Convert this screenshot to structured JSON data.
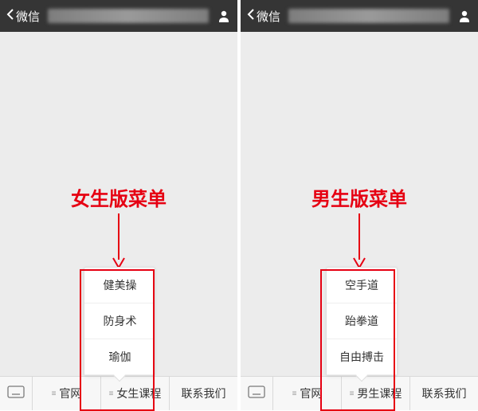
{
  "left": {
    "header": {
      "back": "微信"
    },
    "caption": "女生版菜单",
    "popup": [
      "健美操",
      "防身术",
      "瑜伽"
    ],
    "menus": [
      "官网",
      "女生课程",
      "联系我们"
    ]
  },
  "right": {
    "header": {
      "back": "微信"
    },
    "caption": "男生版菜单",
    "popup": [
      "空手道",
      "跆拳道",
      "自由搏击"
    ],
    "menus": [
      "官网",
      "男生课程",
      "联系我们"
    ]
  }
}
